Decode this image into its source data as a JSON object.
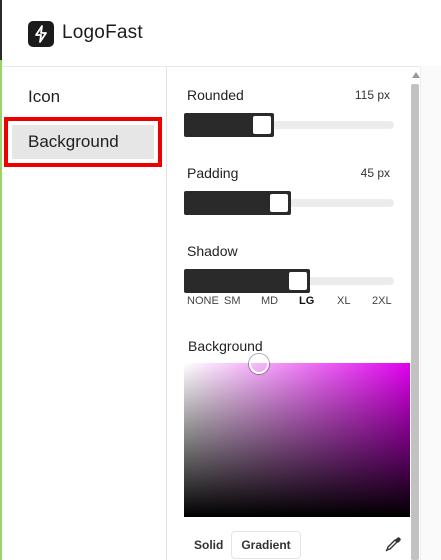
{
  "app": {
    "title": "LogoFast",
    "logo_icon": "lightning-icon"
  },
  "sidebar": {
    "items": [
      {
        "label": "Icon"
      },
      {
        "label": "Background",
        "selected": true
      }
    ]
  },
  "controls": {
    "rounded": {
      "label": "Rounded",
      "value": "115 px",
      "level": 0.43
    },
    "padding": {
      "label": "Padding",
      "value": "45 px",
      "level": 0.51
    },
    "shadow": {
      "label": "Shadow",
      "options": [
        "NONE",
        "SM",
        "MD",
        "LG",
        "XL",
        "2XL"
      ],
      "selected": "LG"
    },
    "background": {
      "label": "Background",
      "color_hue": "#e000ef",
      "modes": {
        "solid": "Solid",
        "gradient": "Gradient"
      },
      "eyedropper_icon": "eyedropper-icon"
    }
  },
  "colors": {
    "accent_dark": "#2a2a2a",
    "highlight": "#ee0000"
  }
}
